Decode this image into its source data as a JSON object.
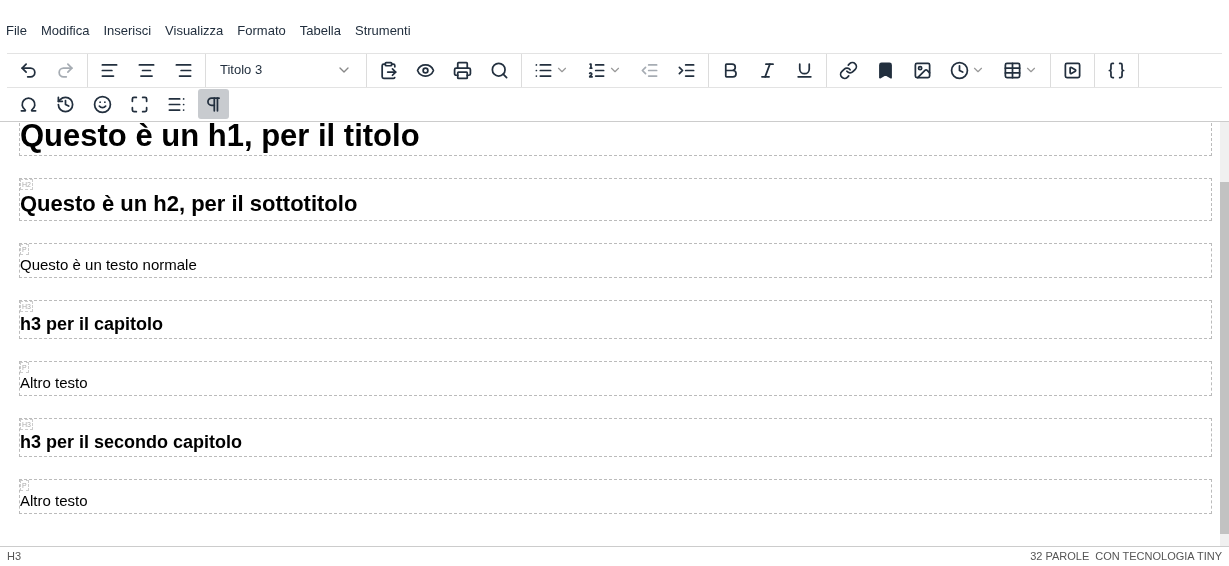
{
  "menu_bar": [
    "File",
    "Modifica",
    "Inserisci",
    "Visualizza",
    "Formato",
    "Tabella",
    "Strumenti"
  ],
  "toolbar_rows": [
    [
      {
        "items": [
          {
            "kind": "undo",
            "disabled": false
          },
          {
            "kind": "redo",
            "disabled": true
          }
        ]
      },
      {
        "items": [
          {
            "kind": "align-left",
            "disabled": false
          },
          {
            "kind": "align-center",
            "disabled": false
          },
          {
            "kind": "align-right",
            "disabled": false
          }
        ]
      },
      {
        "items": [
          {
            "kind": "block-format",
            "value": "Titolo 3"
          }
        ]
      },
      {
        "items": [
          {
            "kind": "paste",
            "disabled": false
          },
          {
            "kind": "preview",
            "disabled": false
          },
          {
            "kind": "print",
            "disabled": false
          },
          {
            "kind": "search",
            "disabled": false
          }
        ]
      },
      {
        "items": [
          {
            "kind": "bullet-list",
            "disabled": false,
            "dropdown": true
          },
          {
            "kind": "number-list",
            "disabled": false,
            "dropdown": true
          },
          {
            "kind": "outdent",
            "disabled": true
          },
          {
            "kind": "indent",
            "disabled": false
          }
        ]
      },
      {
        "items": [
          {
            "kind": "bold",
            "disabled": false
          },
          {
            "kind": "italic",
            "disabled": false
          },
          {
            "kind": "underline",
            "disabled": false
          }
        ]
      },
      {
        "items": [
          {
            "kind": "link",
            "disabled": false
          },
          {
            "kind": "bookmark",
            "disabled": false
          },
          {
            "kind": "image",
            "disabled": false
          },
          {
            "kind": "clock",
            "disabled": false,
            "dropdown": true
          },
          {
            "kind": "table",
            "disabled": false,
            "dropdown": true
          }
        ]
      },
      {
        "items": [
          {
            "kind": "media",
            "disabled": false
          }
        ]
      },
      {
        "items": [
          {
            "kind": "code",
            "disabled": false
          }
        ]
      }
    ],
    [
      {
        "items": [
          {
            "kind": "omega",
            "disabled": false
          },
          {
            "kind": "history",
            "disabled": false
          },
          {
            "kind": "emoji",
            "disabled": false
          },
          {
            "kind": "fullscreen",
            "disabled": false
          },
          {
            "kind": "toc",
            "disabled": false
          },
          {
            "kind": "pilcrow",
            "disabled": false,
            "pressed": true
          }
        ]
      }
    ]
  ],
  "blocks": [
    {
      "kind": "h1",
      "text": "Questo è un h1, per il titolo"
    },
    {
      "kind": "h2",
      "tag": "H2",
      "text": "Questo è un h2, per il sottotitolo"
    },
    {
      "kind": "p",
      "tag": "P",
      "text": "Questo è un testo normale"
    },
    {
      "kind": "h3",
      "tag": "H3",
      "text": "h3 per il capitolo"
    },
    {
      "kind": "p",
      "tag": "P",
      "text": "Altro testo"
    },
    {
      "kind": "h3",
      "tag": "H3",
      "text": "h3 per il secondo capitolo"
    },
    {
      "kind": "p",
      "tag": "P",
      "text": "Altro testo"
    }
  ],
  "status_bar": {
    "path": "H3",
    "word_count": "32 PAROLE",
    "branding": "CON TECNOLOGIA TINY"
  }
}
